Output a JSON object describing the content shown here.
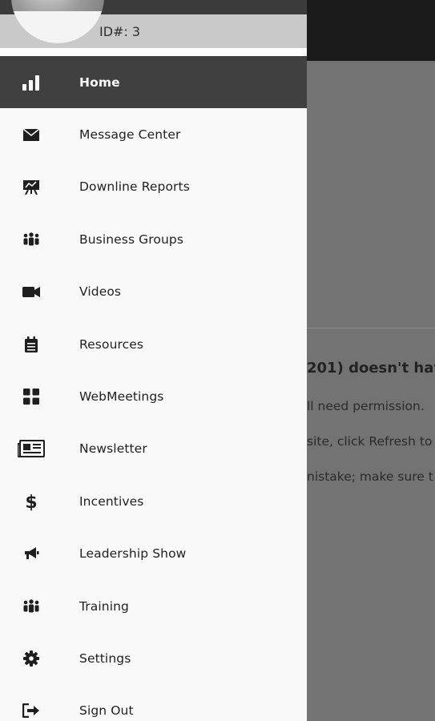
{
  "user": {
    "id_label": "ID#: 3"
  },
  "menu": {
    "items": [
      {
        "label": "Home",
        "icon": "bar-chart-icon",
        "active": true
      },
      {
        "label": "Message Center",
        "icon": "envelope-icon"
      },
      {
        "label": "Downline Reports",
        "icon": "presentation-chart-icon"
      },
      {
        "label": "Business Groups",
        "icon": "group-icon"
      },
      {
        "label": "Videos",
        "icon": "video-camera-icon"
      },
      {
        "label": "Resources",
        "icon": "calendar-list-icon"
      },
      {
        "label": "WebMeetings",
        "icon": "grid-icon"
      },
      {
        "label": "Newsletter",
        "icon": "newspaper-icon"
      },
      {
        "label": "Incentives",
        "icon": "dollar-icon"
      },
      {
        "label": "Leadership Show",
        "icon": "megaphone-icon"
      },
      {
        "label": "Training",
        "icon": "group-icon"
      },
      {
        "label": "Settings",
        "icon": "gear-icon"
      },
      {
        "label": "Sign Out",
        "icon": "sign-out-icon"
      }
    ]
  },
  "background": {
    "heading": "201) doesn't hav",
    "line1": "ll need permission.",
    "line2": "site, click Refresh to",
    "line3": "nistake; make sure t"
  },
  "colors": {
    "drawer_bg": "#f9f9f9",
    "active_item_bg": "#404040",
    "overlay": "#737373"
  }
}
